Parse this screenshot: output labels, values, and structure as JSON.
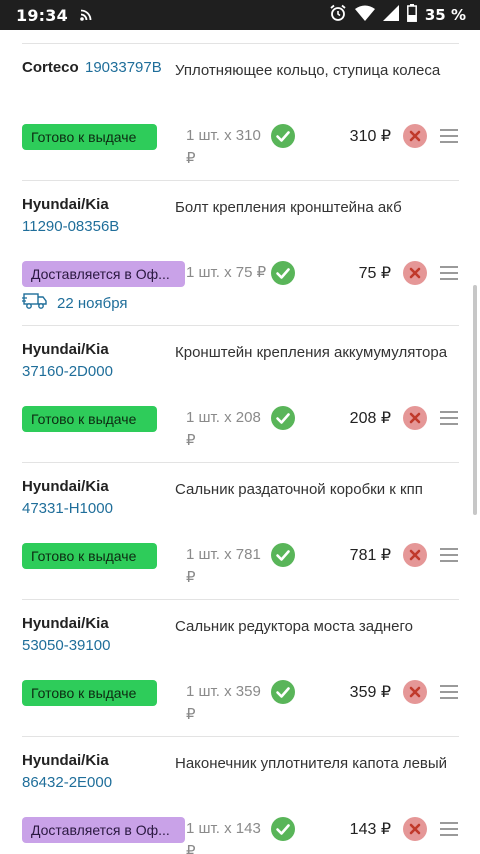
{
  "status_bar": {
    "time": "19:34",
    "battery_percent": "35 %",
    "icons": [
      "cast-icon",
      "alarm-icon",
      "wifi-icon",
      "signal-icon",
      "battery-icon"
    ]
  },
  "status_labels": {
    "ready": "Готово к выдаче",
    "delivering": "Доставляется в Оф..."
  },
  "colors": {
    "ready": "#2ecc5a",
    "delivering": "#c9a2e8",
    "link": "#1f6e9a",
    "confirm": "#59b559",
    "remove": "#e59797"
  },
  "order_items": [
    {
      "brand": "Corteco",
      "article": "19033797B",
      "name": "Уплотняющее кольцо, ступица колеса",
      "status": "Готово к выдаче",
      "qty_text": "1 шт. х 310 ₽",
      "price": "310 ₽"
    },
    {
      "brand": "Hyundai/Kia",
      "article": "11290-08356B",
      "name": "Болт крепления кронштейна акб",
      "status": "Доставляется в Оф...",
      "qty_text": "1 шт. х 75 ₽",
      "price": "75 ₽",
      "delivery_date": "22 ноября"
    },
    {
      "brand": "Hyundai/Kia",
      "article": "37160-2D000",
      "name": "Кронштейн крепления аккумумулятора",
      "status": "Готово к выдаче",
      "qty_text": "1 шт. х 208 ₽",
      "price": "208 ₽"
    },
    {
      "brand": "Hyundai/Kia",
      "article": "47331-H1000",
      "name": "Сальник раздаточной коробки к кпп",
      "status": "Готово к выдаче",
      "qty_text": "1 шт. х 781 ₽",
      "price": "781 ₽"
    },
    {
      "brand": "Hyundai/Kia",
      "article": "53050-39100",
      "name": "Сальник редуктора моста заднего",
      "status": "Готово к выдаче",
      "qty_text": "1 шт. х 359 ₽",
      "price": "359 ₽"
    },
    {
      "brand": "Hyundai/Kia",
      "article": "86432-2E000",
      "name": "Наконечник уплотнителя капота левый",
      "status": "Доставляется в Оф...",
      "qty_text": "1 шт. х 143 ₽",
      "price": "143 ₽"
    }
  ]
}
